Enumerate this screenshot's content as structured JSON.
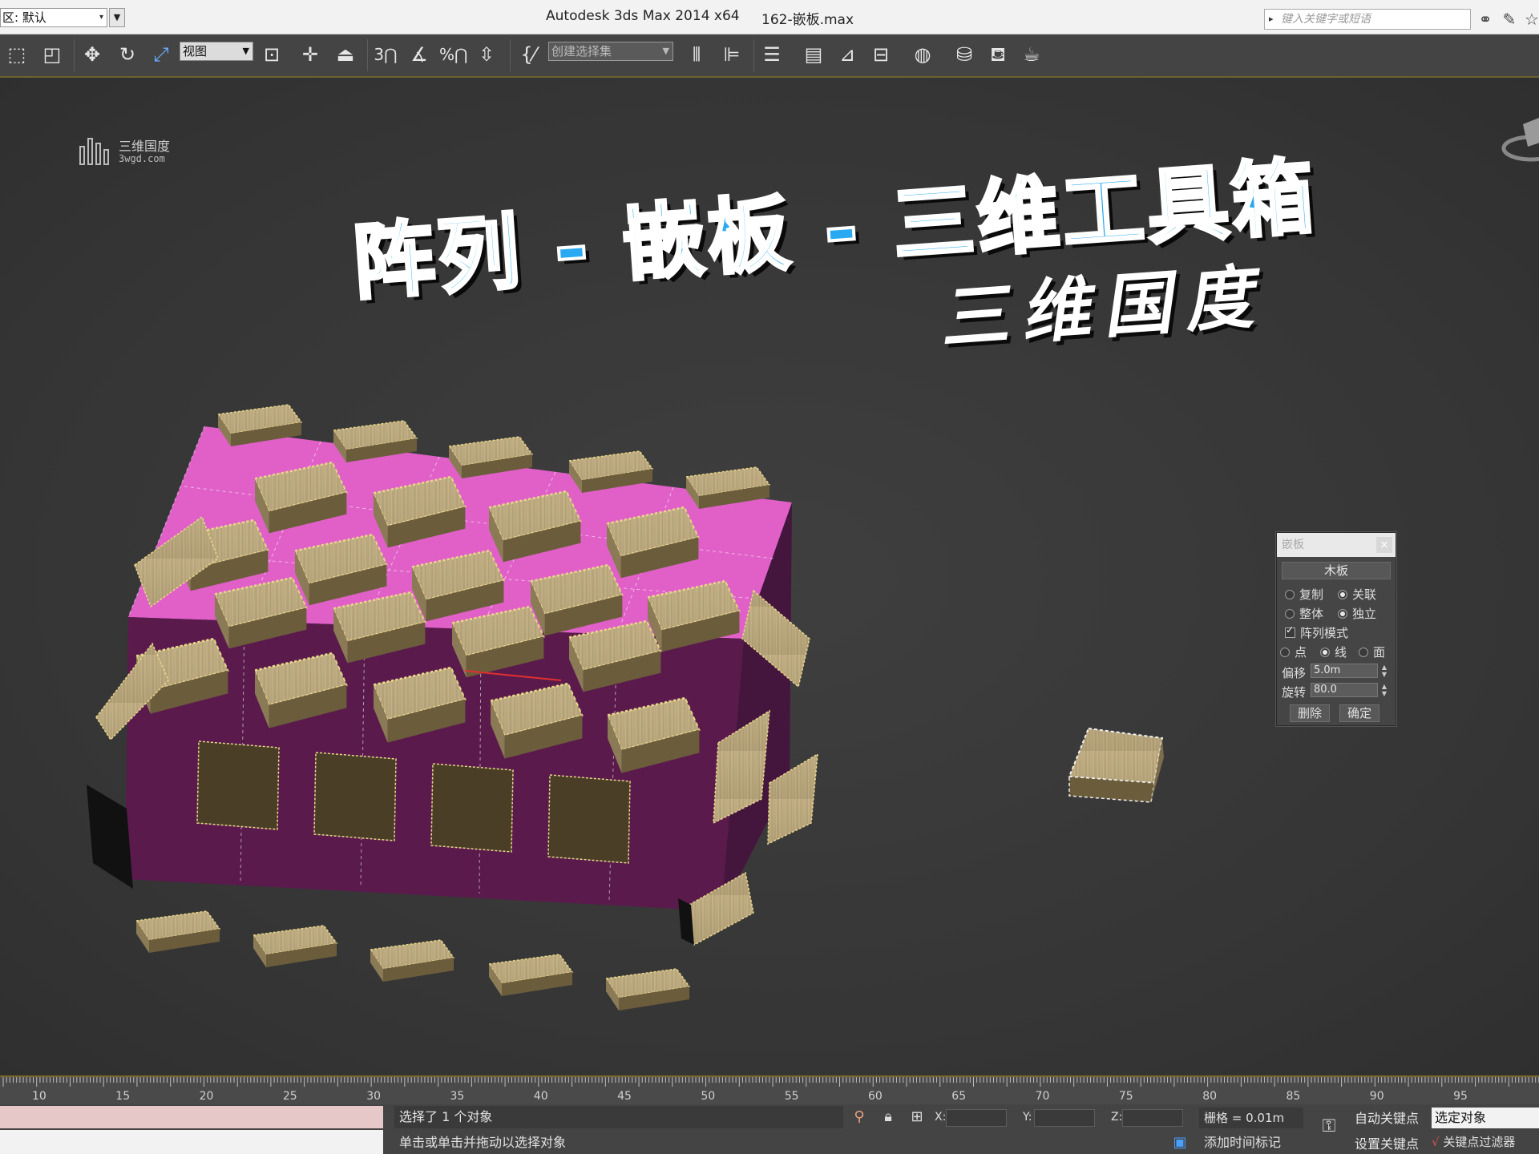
{
  "titlebar": {
    "workspace_label": "区: 默认",
    "app_title": "Autodesk 3ds Max  2014 x64",
    "file_title": "162-嵌板.max",
    "search_placeholder": "键入关键字或短语"
  },
  "toolbar": {
    "view_select": "视图",
    "selection_set_placeholder": "创建选择集",
    "snap_3d_label": "3",
    "percent_snap_label": "%"
  },
  "viewport": {
    "logo_name": "三维国度",
    "logo_url": "3wgd.com",
    "title_main": "阵列 - 嵌板 - 三维工具箱",
    "title_sub": "三维国度"
  },
  "dialog": {
    "title": "嵌板",
    "close": "×",
    "material_button": "木板",
    "copy": "复制",
    "instance": "关联",
    "whole": "整体",
    "independent": "独立",
    "array_mode": "阵列模式",
    "point": "点",
    "line": "线",
    "face": "面",
    "offset_label": "偏移",
    "offset_value": "5.0m",
    "rotate_label": "旋转",
    "rotate_value": "80.0",
    "delete_button": "删除",
    "ok_button": "确定",
    "state": {
      "copy": false,
      "instance": true,
      "whole": false,
      "independent": true,
      "array_mode": true,
      "point": false,
      "line": true,
      "face": false
    }
  },
  "ruler": {
    "labels": [
      "10",
      "15",
      "20",
      "25",
      "30",
      "35",
      "40",
      "45",
      "50",
      "55",
      "60",
      "65",
      "70",
      "75",
      "80",
      "85",
      "90",
      "95"
    ]
  },
  "statusbar": {
    "selected": "选择了 1 个对象",
    "hint": "单击或单击并拖动以选择对象",
    "x_label": "X:",
    "y_label": "Y:",
    "z_label": "Z:",
    "grid": "栅格 = 0.01m",
    "add_time_tag": "添加时间标记",
    "auto_key": "自动关键点",
    "set_key": "设置关键点",
    "selected_object": "选定对象",
    "key_filter": "关键点过滤器"
  },
  "colors": {
    "title_blue": "#29a9f2",
    "pink_face": "#e060c8",
    "dark_face": "#5a1b4c",
    "wood": "#b9a67a"
  }
}
